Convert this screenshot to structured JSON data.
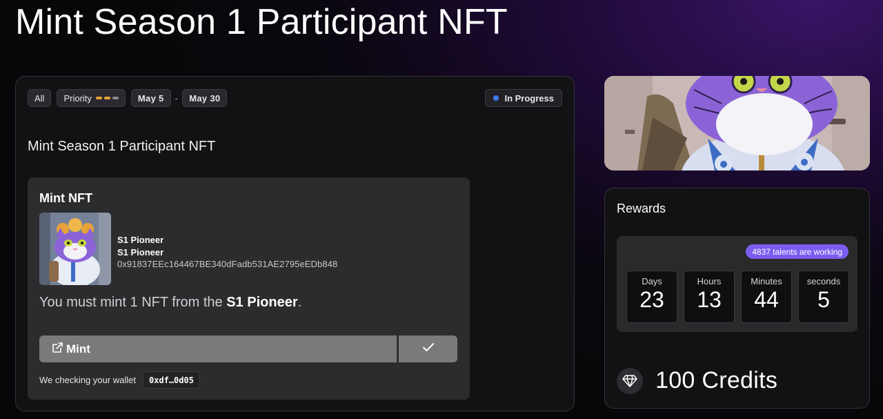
{
  "page": {
    "title": "Mint Season 1 Participant NFT"
  },
  "filters": {
    "all_label": "All",
    "priority_label": "Priority",
    "start_date": "May 5",
    "separator": "-",
    "end_date": "May 30"
  },
  "status": {
    "label": "In Progress",
    "dot_color": "#3b7bf0"
  },
  "quest": {
    "heading": "Mint Season 1 Participant NFT"
  },
  "task": {
    "title": "Mint NFT",
    "collection_name": "S1 Pioneer",
    "collection_subtitle": "S1 Pioneer",
    "contract_address": "0x91837EEc164467BE340dFadb531AE2795eEDb848",
    "desc_prefix": "You must mint 1 NFT from the ",
    "desc_highlight": "S1 Pioneer",
    "desc_suffix": ".",
    "mint_label": "Mint",
    "wallet_note": "We checking your wallet",
    "wallet_short": "0xdf…0d05"
  },
  "rewards": {
    "title": "Rewards",
    "talents_badge": "4837 talents are working",
    "countdown": [
      {
        "label": "Days",
        "value": "23"
      },
      {
        "label": "Hours",
        "value": "13"
      },
      {
        "label": "Minutes",
        "value": "44"
      },
      {
        "label": "seconds",
        "value": "5"
      }
    ],
    "credits": "100 Credits"
  },
  "icons": {
    "status": "dot-icon",
    "mint": "external-link-icon",
    "verify": "check-icon",
    "credits": "diamond-icon"
  },
  "colors": {
    "accent": "#7c5df0",
    "priority": "#e8a23a",
    "status": "#3b7bf0"
  }
}
